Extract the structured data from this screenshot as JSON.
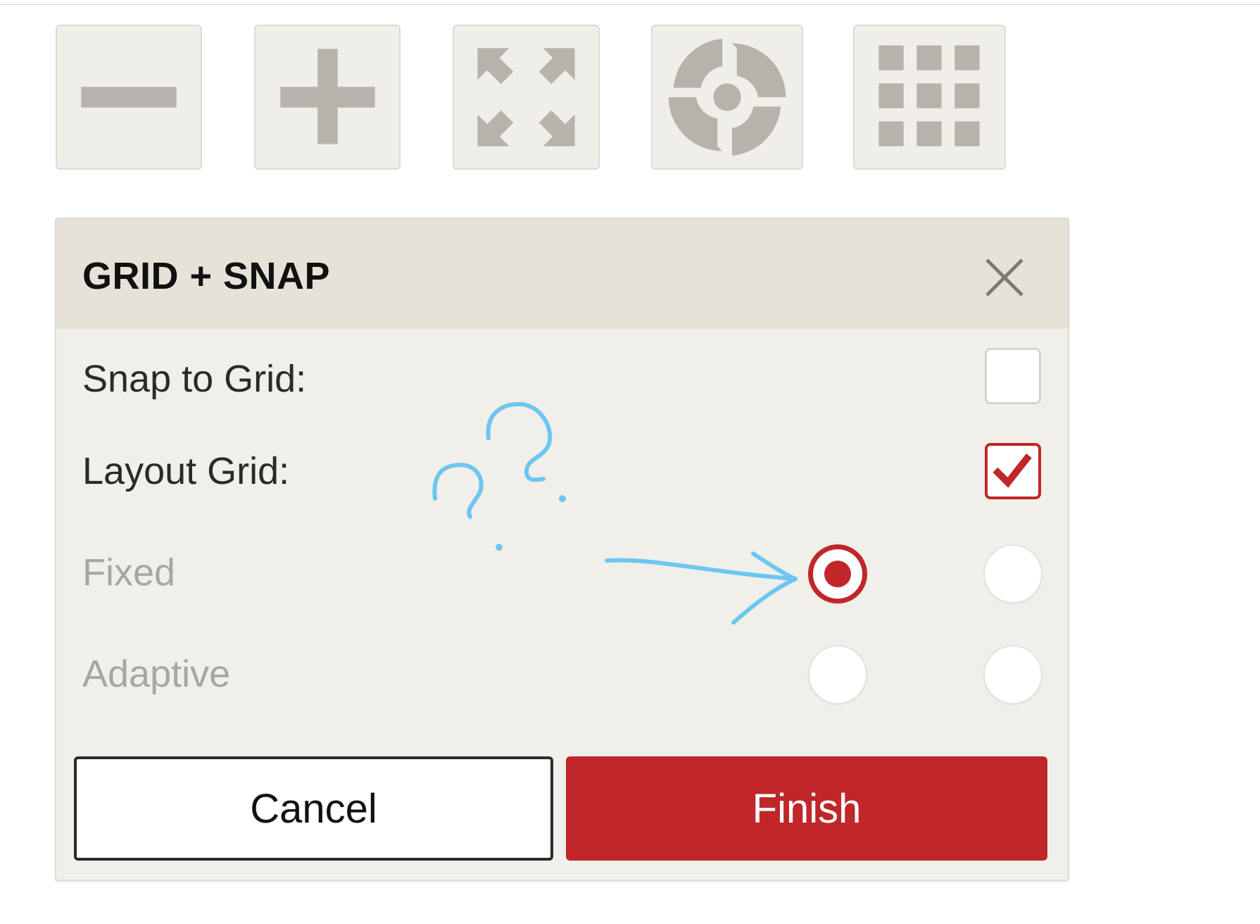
{
  "toolbar": {
    "buttons": [
      {
        "name": "zoom-out",
        "icon": "minus-icon"
      },
      {
        "name": "zoom-in",
        "icon": "plus-icon"
      },
      {
        "name": "fit-to-screen",
        "icon": "expand-arrows-icon"
      },
      {
        "name": "center",
        "icon": "target-icon"
      },
      {
        "name": "grid",
        "icon": "grid-icon"
      }
    ]
  },
  "dialog": {
    "title": "GRID + SNAP",
    "close_icon": "close-icon",
    "rows": {
      "snap_to_grid": {
        "label": "Snap to Grid:",
        "checked": false
      },
      "layout_grid": {
        "label": "Layout Grid:",
        "checked": true
      },
      "fixed": {
        "label": "Fixed"
      },
      "adaptive": {
        "label": "Adaptive"
      }
    },
    "radio_state": {
      "fixed_col1": true,
      "fixed_col2": false,
      "adaptive_col1": false,
      "adaptive_col2": false
    },
    "cancel_label": "Cancel",
    "finish_label": "Finish"
  },
  "colors": {
    "accent": "#c0262a",
    "icon_gray": "#b8b3aa",
    "dialog_bg": "#f1efea",
    "header_bg": "#e6e2d8",
    "annotation": "#6ec6f0"
  }
}
